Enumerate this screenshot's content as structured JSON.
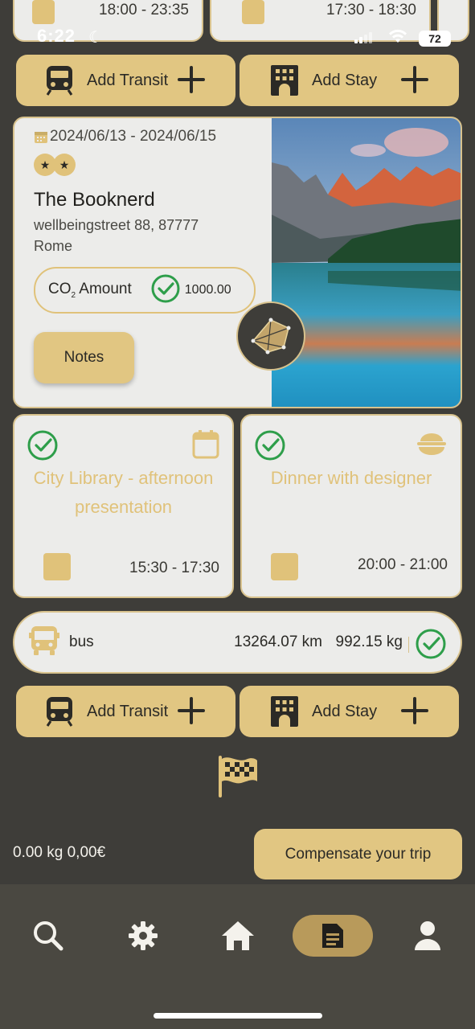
{
  "status_bar": {
    "time": "6:22",
    "battery": "72"
  },
  "top_cards": [
    {
      "time": "18:00 - 23:35"
    },
    {
      "time": "17:30 - 18:30"
    }
  ],
  "actions_top": {
    "add_transit": "Add Transit",
    "add_stay": "Add Stay"
  },
  "stay": {
    "dates": "2024/06/13 - 2024/06/15",
    "stars": 2,
    "name": "The Booknerd",
    "address_line1": "wellbeingstreet 88, 87777",
    "address_line2": "Rome",
    "co2_label": "CO",
    "co2_sub": "2",
    "co2_label_rest": " Amount",
    "co2_value": "1000.00",
    "notes_label": "Notes"
  },
  "activities": [
    {
      "title": "City Library - afternoon presentation",
      "time": "15:30 - 17:30",
      "icon": "calendar-icon"
    },
    {
      "title": "Dinner with designer",
      "time": "20:00 - 21:00",
      "icon": "food-bowl-icon"
    }
  ],
  "transit": {
    "mode": "bus",
    "distance": "13264.07 km",
    "emissions": "992.15 kg"
  },
  "actions_bottom": {
    "add_transit": "Add Transit",
    "add_stay": "Add Stay"
  },
  "totals": {
    "text": "0.00 kg 0,00€"
  },
  "compensate_label": "Compensate your trip",
  "colors": {
    "accent": "#e1c682",
    "background": "#3e3d39",
    "card": "#ececea",
    "success": "#2e9e4a"
  },
  "nav": [
    {
      "name": "search",
      "active": false
    },
    {
      "name": "settings",
      "active": false
    },
    {
      "name": "home",
      "active": false
    },
    {
      "name": "document",
      "active": true
    },
    {
      "name": "profile",
      "active": false
    }
  ]
}
